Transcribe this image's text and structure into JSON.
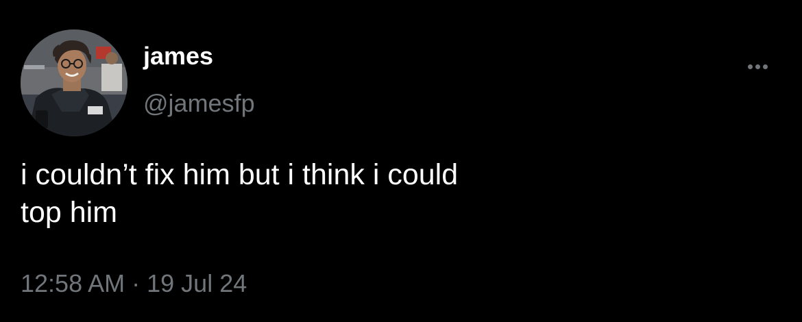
{
  "tweet": {
    "author": {
      "display_name": "james",
      "handle": "@jamesfp"
    },
    "more_icon": "more-horizontal-icon",
    "text": "i couldn’t fix him but i think i could\ntop him",
    "time": "12:58 AM",
    "separator": "·",
    "date": "19 Jul 24"
  },
  "colors": {
    "background": "#000000",
    "primary_text": "#ffffff",
    "secondary_text": "#71767b"
  }
}
